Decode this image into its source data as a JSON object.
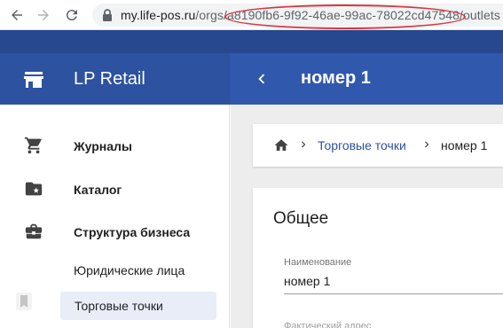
{
  "browser": {
    "url_host": "my.life-pos.ru",
    "url_path": "/orgs/a8190fb6-9f92-46ae-99ac-78022cd47548/outlets"
  },
  "header": {
    "app_title": "LP Retail",
    "page_title": "номер 1"
  },
  "sidebar": {
    "items": [
      {
        "label": "Журналы",
        "icon": "cart-icon"
      },
      {
        "label": "Каталог",
        "icon": "folder-star-icon"
      },
      {
        "label": "Структура бизнеса",
        "icon": "briefcase-icon"
      }
    ],
    "subitems": [
      {
        "label": "Юридические лица"
      },
      {
        "label": "Торговые точки",
        "active": true
      }
    ]
  },
  "breadcrumb": {
    "items": [
      "Торговые точки",
      "номер 1"
    ]
  },
  "form": {
    "section_title": "Общее",
    "name_label": "Наименование",
    "name_value": "номер 1",
    "address_label": "Фактический адрес"
  },
  "colors": {
    "header": "#2d52a0",
    "accent_link": "#2d52a0",
    "highlight": "#d9363e"
  }
}
